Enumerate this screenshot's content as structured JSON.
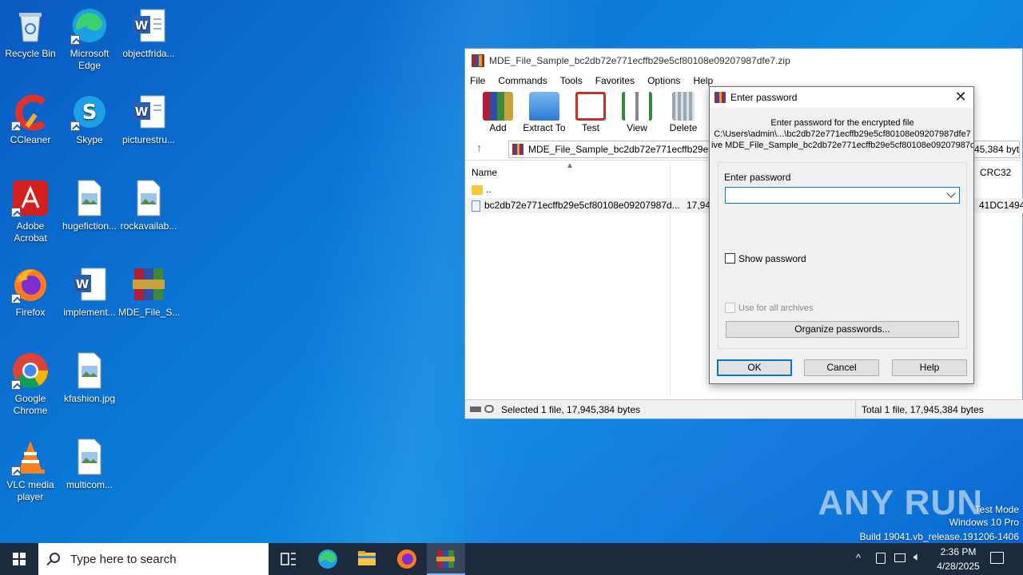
{
  "desktop": {
    "icons": [
      {
        "label": "Recycle Bin"
      },
      {
        "label": "Microsoft Edge"
      },
      {
        "label": "objectfrida..."
      },
      {
        "label": "CCleaner"
      },
      {
        "label": "Skype"
      },
      {
        "label": "picturestru..."
      },
      {
        "label": "Adobe Acrobat"
      },
      {
        "label": "hugefiction..."
      },
      {
        "label": "rockavailab..."
      },
      {
        "label": "Firefox"
      },
      {
        "label": "implement..."
      },
      {
        "label": "MDE_File_S..."
      },
      {
        "label": "Google Chrome"
      },
      {
        "label": "kfashion.jpg"
      },
      {
        "label": "VLC media player"
      },
      {
        "label": "multicom..."
      }
    ]
  },
  "winrar": {
    "title": "MDE_File_Sample_bc2db72e771ecffb29e5cf80108e09207987dfe7.zip",
    "menu": [
      "File",
      "Commands",
      "Tools",
      "Favorites",
      "Options",
      "Help"
    ],
    "toolbar": [
      "Add",
      "Extract To",
      "Test",
      "View",
      "Delete"
    ],
    "address": "MDE_File_Sample_bc2db72e771ecffb29e5cf80108e09207987dfe7.zip - ZIP archive, unpacked size 17,945,384 bytes",
    "columns": {
      "name": "Name",
      "crc": "CRC32"
    },
    "rows": [
      {
        "name": "..",
        "size": "",
        "crc": ""
      },
      {
        "name": "bc2db72e771ecffb29e5cf80108e09207987d...",
        "size": "17,94",
        "crc": "41DC1494"
      }
    ],
    "status_left": "Selected 1 file, 17,945,384 bytes",
    "status_right": "Total 1 file, 17,945,384 bytes"
  },
  "dialog": {
    "title": "Enter password",
    "info_line1": "Enter password for the encrypted file",
    "info_line2": "C:\\Users\\admin\\...\\bc2db72e771ecffb29e5cf80108e09207987dfe7",
    "info_line3": "ive MDE_File_Sample_bc2db72e771ecffb29e5cf80108e09207987df",
    "password_label": "Enter password",
    "password_value": "",
    "show_password": "Show password",
    "use_for_all": "Use for all archives",
    "organize": "Organize passwords...",
    "ok": "OK",
    "cancel": "Cancel",
    "help": "Help"
  },
  "watermark": {
    "brand": "ANY RUN",
    "line1": "Test Mode",
    "line2": "Windows 10 Pro",
    "line3": "Build 19041.vb_release.191206-1406"
  },
  "taskbar": {
    "search_placeholder": "Type here to search",
    "time": "2:36 PM",
    "date": "4/28/2025"
  }
}
